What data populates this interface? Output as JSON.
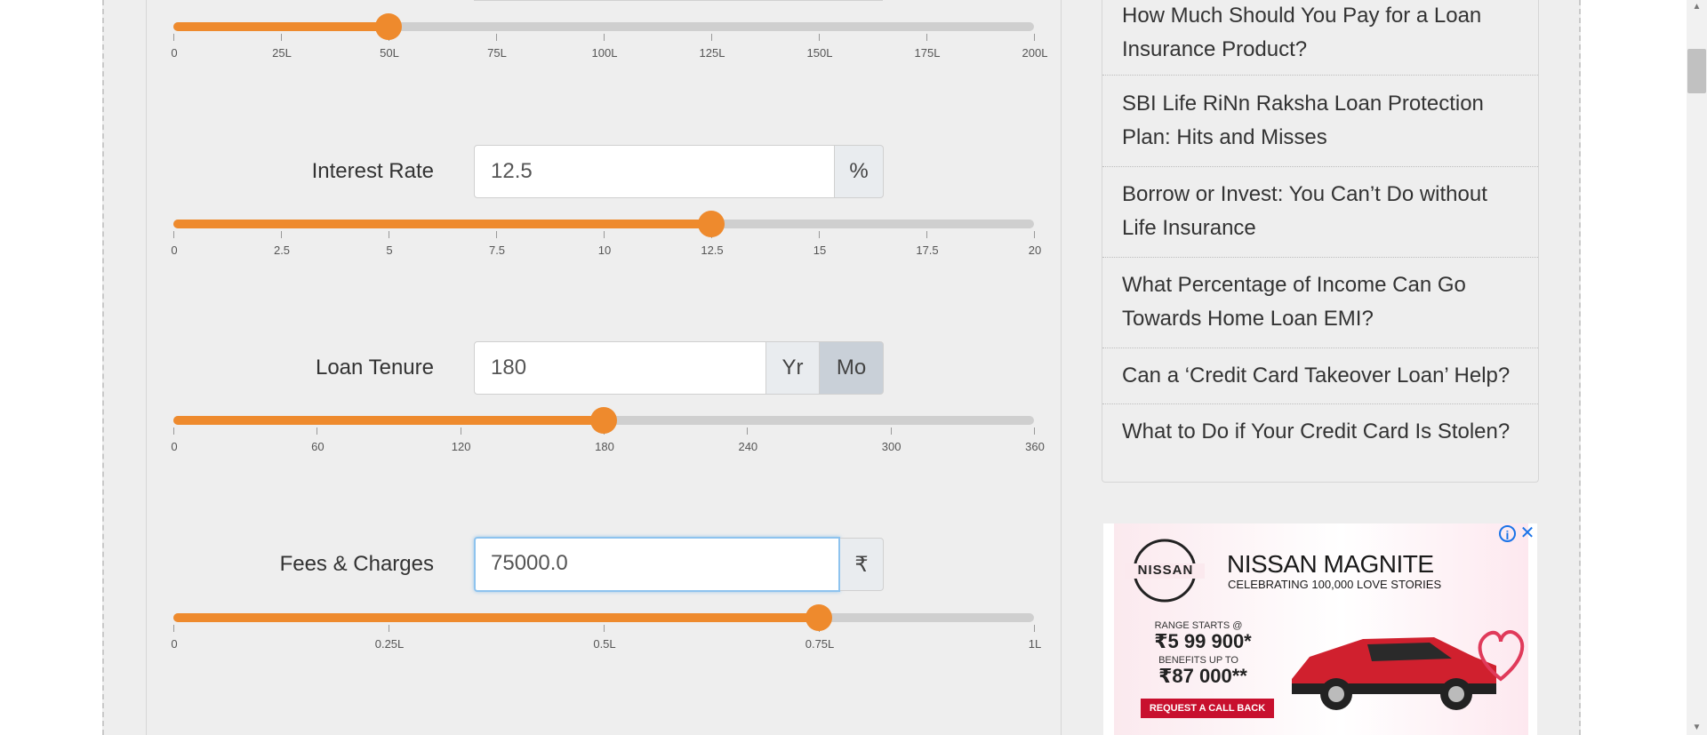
{
  "calculator": {
    "loan_amount": {
      "value_fraction": 0.25,
      "ticks": [
        "0",
        "25L",
        "50L",
        "75L",
        "100L",
        "125L",
        "150L",
        "175L",
        "200L"
      ]
    },
    "interest_rate": {
      "label": "Interest Rate",
      "value": "12.5",
      "unit": "%",
      "value_fraction": 0.625,
      "ticks": [
        "0",
        "2.5",
        "5",
        "7.5",
        "10",
        "12.5",
        "15",
        "17.5",
        "20"
      ]
    },
    "loan_tenure": {
      "label": "Loan Tenure",
      "value": "180",
      "unit_year": "Yr",
      "unit_month": "Mo",
      "selected_unit": "Mo",
      "value_fraction": 0.5,
      "ticks": [
        "0",
        "60",
        "120",
        "180",
        "240",
        "300",
        "360"
      ]
    },
    "fees_charges": {
      "label": "Fees & Charges",
      "value": "75000.0",
      "unit": "₹",
      "value_fraction": 0.75,
      "ticks": [
        "0",
        "0.25L",
        "0.5L",
        "0.75L",
        "1L"
      ]
    }
  },
  "sidebar": {
    "articles": [
      "How Much Should You Pay for a Loan Insurance Product?",
      "SBI Life RiNn Raksha Loan Protection Plan: Hits and Misses",
      "Borrow or Invest: You Can’t Do without Life Insurance",
      "What Percentage of Income Can Go Towards Home Loan EMI?",
      "Can a ‘Credit Card Takeover Loan’ Help?",
      "What to Do if Your Credit Card Is Stolen?"
    ]
  },
  "ad": {
    "brand": "NISSAN",
    "title": "NISSAN MAGNITE",
    "subtitle": "CELEBRATING 100,000 LOVE STORIES",
    "price_label": "RANGE STARTS @",
    "price": "₹5 99 900*",
    "benefit_label": "BENEFITS UP TO",
    "benefit": "₹87 000**",
    "cta": "REQUEST A CALL BACK",
    "colors": {
      "cta": "#c8102e",
      "car": "#d0202e"
    }
  },
  "colors": {
    "accent": "#ee8a2d",
    "track": "#cfcfcf",
    "background": "#eeeeee"
  }
}
